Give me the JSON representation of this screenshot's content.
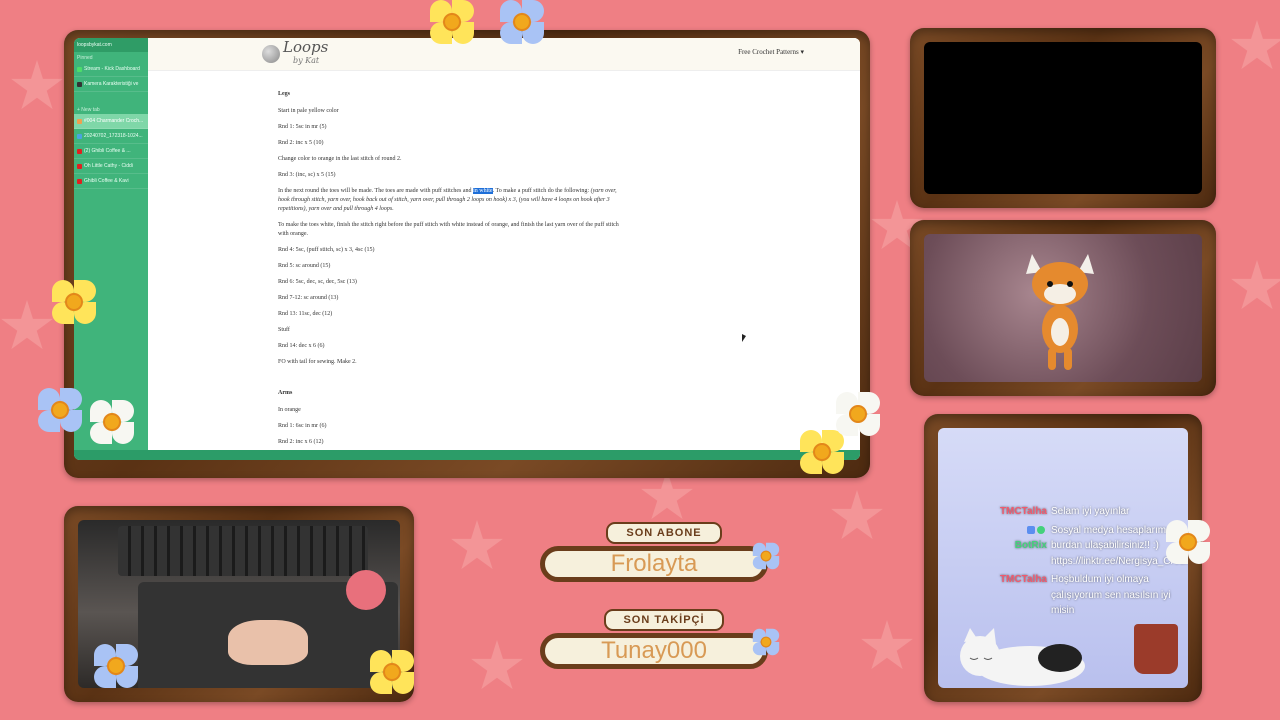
{
  "browser": {
    "sidebar": {
      "url": "loopsbykat.com",
      "section_pinned": "Pinned",
      "items_top": [
        {
          "label": "Stream - Kick Dashboard",
          "color": "#4ddc6a"
        },
        {
          "label": "Kamera Karakteristiği ve",
          "color": "#333"
        }
      ],
      "section_new": "+ New tab",
      "items": [
        {
          "label": "#004 Charmander Croch...",
          "color": "#f0a050",
          "active": true
        },
        {
          "label": "20240702_172318-1024...",
          "color": "#4aa3e0",
          "active": false
        },
        {
          "label": "(2) Ghibli Coffee & ...",
          "color": "#e02020",
          "active": false
        },
        {
          "label": "Oh Little Cathy - Ciddi",
          "color": "#e02020",
          "active": false
        },
        {
          "label": "Ghibli Coffee & Kavi",
          "color": "#e02020",
          "active": false
        }
      ]
    },
    "site": {
      "logo_main": "Loops",
      "logo_sub": "by Kat",
      "nav": "Free Crochet Patterns"
    },
    "article": {
      "legs_heading": "Legs",
      "legs_intro": "Start in pale yellow color",
      "rnd1": "Rnd 1: 5sc in mr (5)",
      "rnd2": "Rnd 2: inc x 5 (10)",
      "change_color": "Change color to orange in the last stitch of round 2.",
      "rnd3": "Rnd 3: (inc, sc) x 5 (15)",
      "toes_before": "In the next round the toes will be made. The toes are made with puff stitches and ",
      "toes_highlight": "in white",
      "toes_after": ". To make a puff stitch do the following: ",
      "toes_italic": "(yarn over, hook through stitch, yarn over, hook back out of stitch, yarn over, pull through 2 loops on hook) x 3, (you will have 4 loops on hook after 3 repetitions), yarn over and pull through 4 loops.",
      "toes_white": "To make the toes white, finish the stitch right before the puff stitch with white instead of orange, and finish the last yarn over of the puff stitch with orange.",
      "rnd4": "Rnd 4: 5sc, (puff stitch, sc) x 3, 4sc (15)",
      "rnd5": "Rnd 5: sc around (15)",
      "rnd6": "Rnd 6: 5sc, dec, sc, dec, 5sc (13)",
      "rnd7": "Rnd 7-12: sc around (13)",
      "rnd13": "Rnd 13: 11sc, dec (12)",
      "stuff": "Stuff",
      "rnd14": "Rnd 14: dec x 6 (6)",
      "fo": "FO with tail for sewing. Make 2.",
      "arms_heading": "Arms",
      "arms_intro": "In orange",
      "arms_rnd1": "Rnd 1: 6sc in mr (6)",
      "arms_rnd2": "Rnd 2: inc x 6 (12)"
    }
  },
  "overlay": {
    "last_sub_label": "SON ABONE",
    "last_sub_name": "Frolayta",
    "last_follower_label": "SON TAKİPÇİ",
    "last_follower_name": "Tunay000"
  },
  "chat": {
    "messages": [
      {
        "user": "TMCTalha",
        "user_color": "#f05a6e",
        "text": "Selam iyi yayınlar"
      },
      {
        "user": "BotRix",
        "user_color": "#44d17c",
        "text": "Sosyal medya hesaplarıma burdan ulaşabilirsiniz!! :) https://linktr.ee/Nergisya_Crochet"
      },
      {
        "user": "TMCTalha",
        "user_color": "#f05a6e",
        "text": "Hoşbuldum iyi olmaya çalışıyorum sen nasılsın iyi misin"
      }
    ]
  },
  "colors": {
    "background": "#ef7f84",
    "wood": "#6a3d1b",
    "sidebar": "#40b47b",
    "highlight": "#1e6fd9"
  }
}
